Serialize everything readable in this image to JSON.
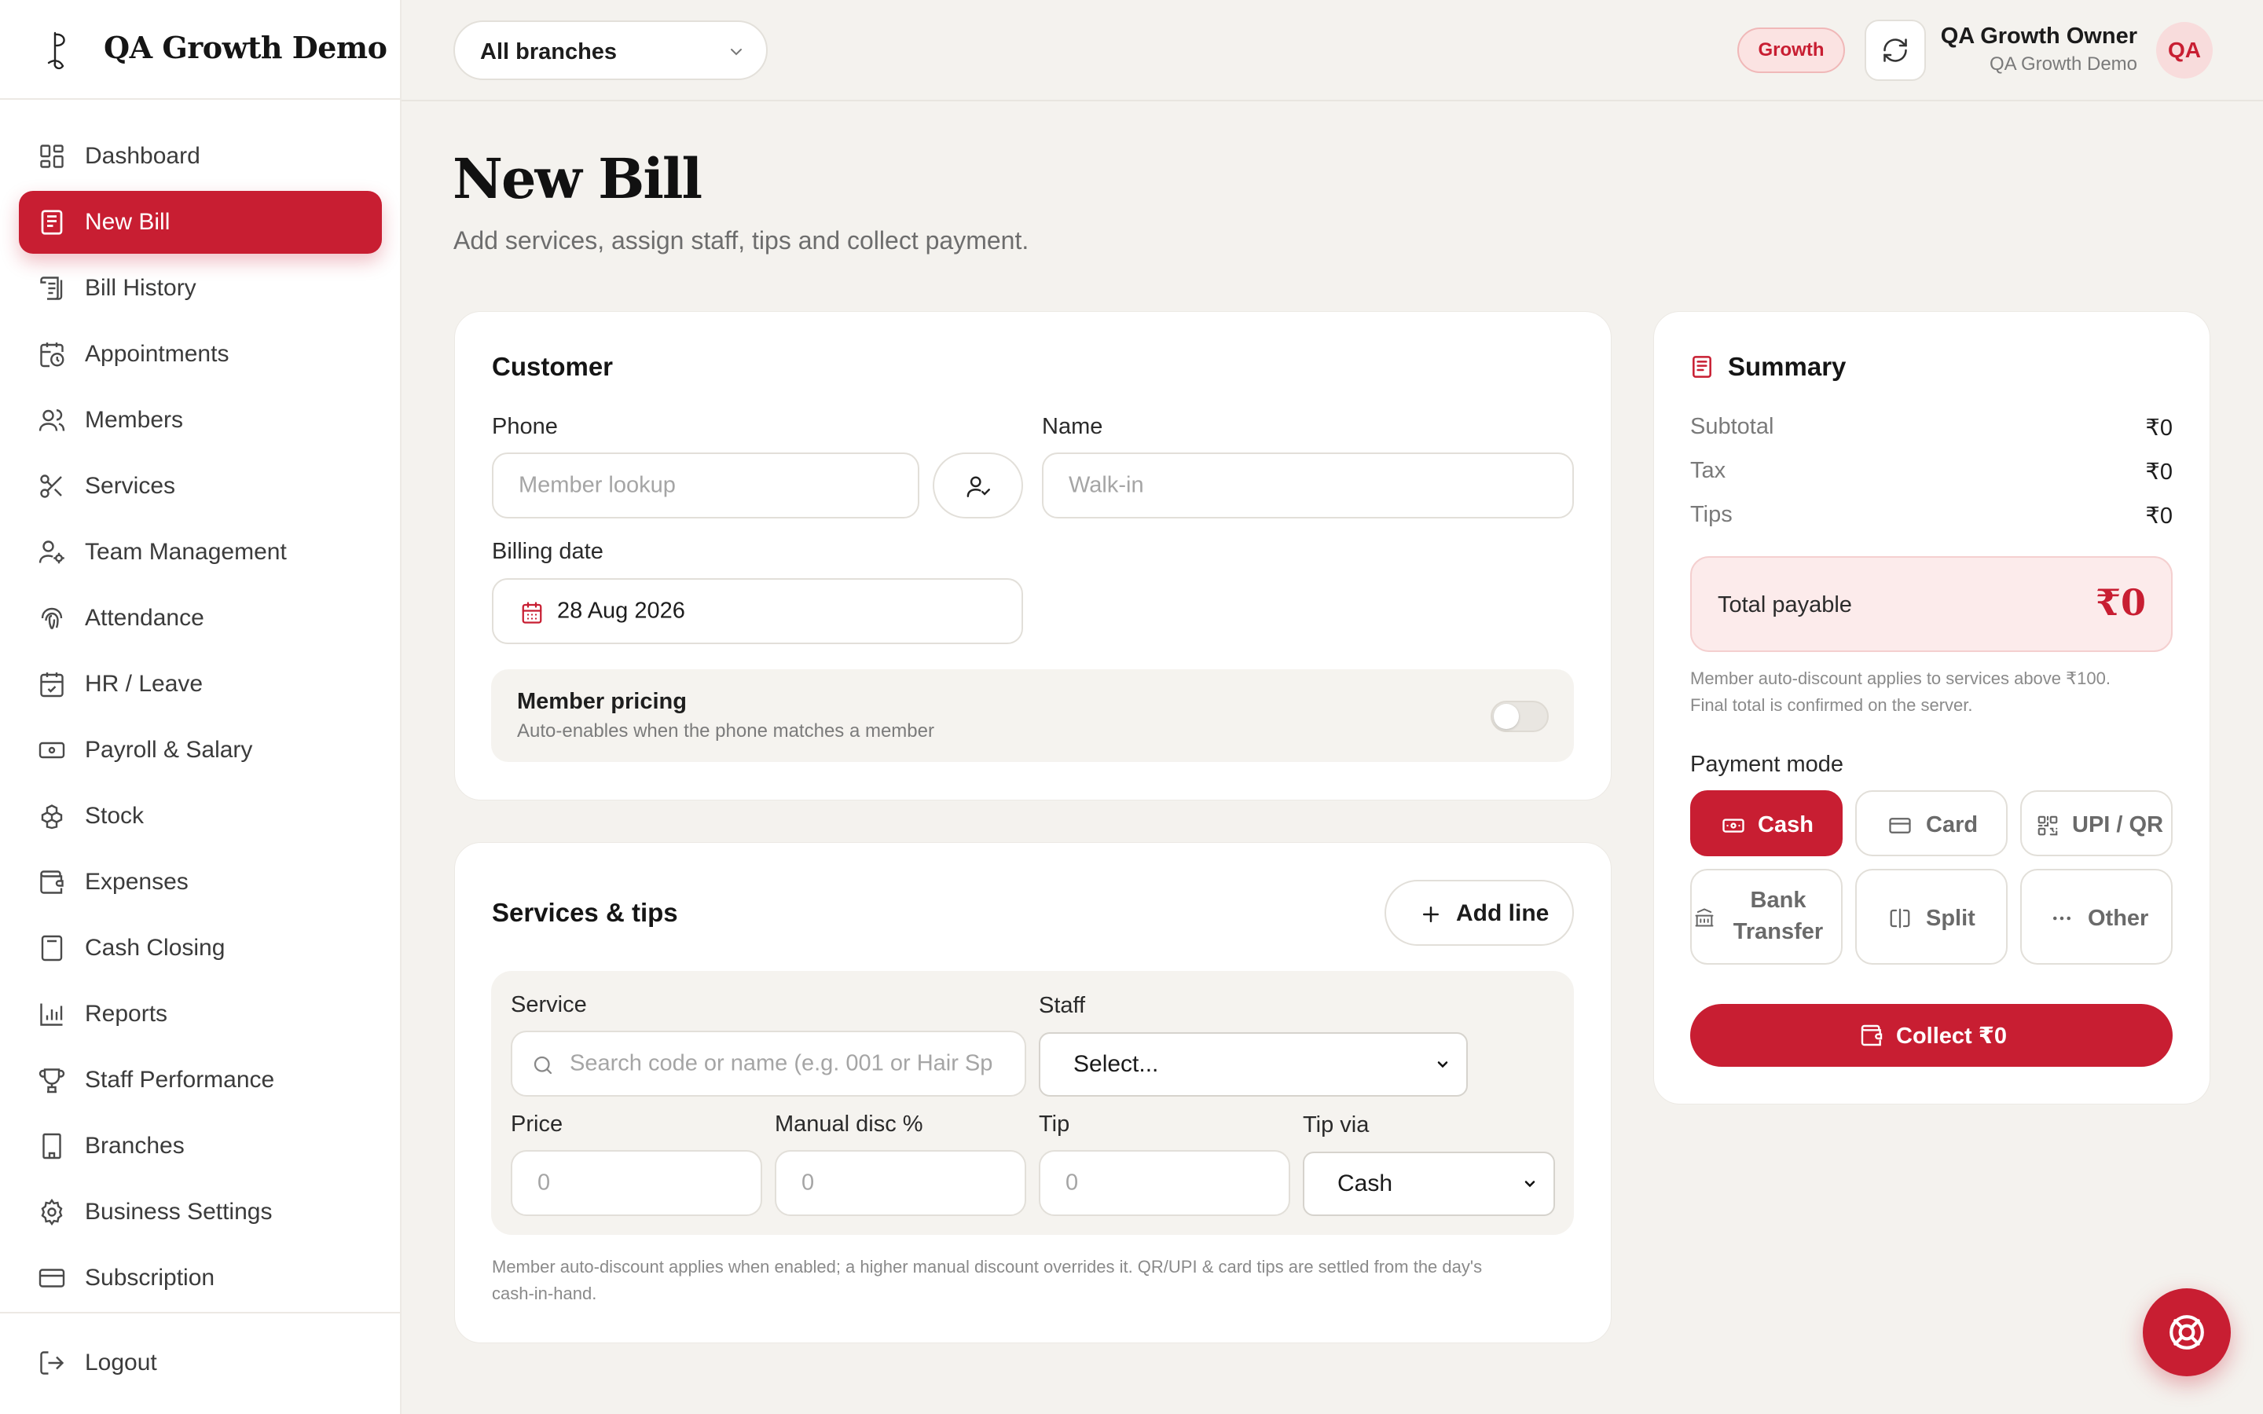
{
  "brand": {
    "name": "QA Growth Demo"
  },
  "sidebar": {
    "items": [
      {
        "label": "Dashboard",
        "icon": "dashboard-icon",
        "active": false
      },
      {
        "label": "New Bill",
        "icon": "receipt-icon",
        "active": true
      },
      {
        "label": "Bill History",
        "icon": "scroll-icon",
        "active": false
      },
      {
        "label": "Appointments",
        "icon": "calendar-clock-icon",
        "active": false
      },
      {
        "label": "Members",
        "icon": "users-icon",
        "active": false
      },
      {
        "label": "Services",
        "icon": "scissors-icon",
        "active": false
      },
      {
        "label": "Team Management",
        "icon": "user-cog-icon",
        "active": false
      },
      {
        "label": "Attendance",
        "icon": "fingerprint-icon",
        "active": false
      },
      {
        "label": "HR / Leave",
        "icon": "calendar-check-icon",
        "active": false
      },
      {
        "label": "Payroll & Salary",
        "icon": "banknote-icon",
        "active": false
      },
      {
        "label": "Stock",
        "icon": "boxes-icon",
        "active": false
      },
      {
        "label": "Expenses",
        "icon": "wallet-icon",
        "active": false
      },
      {
        "label": "Cash Closing",
        "icon": "calculator-icon",
        "active": false
      },
      {
        "label": "Reports",
        "icon": "bar-chart-icon",
        "active": false
      },
      {
        "label": "Staff Performance",
        "icon": "trophy-icon",
        "active": false
      },
      {
        "label": "Branches",
        "icon": "building-icon",
        "active": false
      },
      {
        "label": "Business Settings",
        "icon": "gear-icon",
        "active": false
      },
      {
        "label": "Subscription",
        "icon": "credit-card-icon",
        "active": false
      }
    ],
    "logout_label": "Logout"
  },
  "topbar": {
    "branch_selected": "All branches",
    "plan_badge": "Growth",
    "user_name": "QA Growth Owner",
    "user_org": "QA Growth Demo",
    "avatar_initials": "QA"
  },
  "page": {
    "title": "New Bill",
    "subtitle": "Add services, assign staff, tips and collect payment."
  },
  "customer": {
    "title": "Customer",
    "phone_label": "Phone",
    "phone_placeholder": "Member lookup",
    "name_label": "Name",
    "name_placeholder": "Walk-in",
    "billing_date_label": "Billing date",
    "billing_date_value": "28 Aug 2026",
    "member_pricing_title": "Member pricing",
    "member_pricing_desc": "Auto-enables when the phone matches a member",
    "member_pricing_enabled": false
  },
  "services": {
    "title": "Services & tips",
    "add_line_label": "Add line",
    "service_label": "Service",
    "service_placeholder": "Search code or name (e.g. 001 or Hair Sp",
    "staff_label": "Staff",
    "staff_selected": "Select...",
    "price_label": "Price",
    "price_placeholder": "0",
    "manual_disc_label": "Manual disc %",
    "manual_disc_placeholder": "0",
    "tip_label": "Tip",
    "tip_placeholder": "0",
    "tip_via_label": "Tip via",
    "tip_via_selected": "Cash",
    "footnote_line1": "Member auto-discount applies when enabled; a higher manual discount overrides it. QR/UPI & card tips are settled from the day's",
    "footnote_line2": "cash-in-hand."
  },
  "summary": {
    "title": "Summary",
    "subtotal_label": "Subtotal",
    "subtotal_value": "₹0",
    "tax_label": "Tax",
    "tax_value": "₹0",
    "tips_label": "Tips",
    "tips_value": "₹0",
    "total_label": "Total payable",
    "total_value": "₹0",
    "note_line1": "Member auto-discount applies to services above ₹100.",
    "note_line2": "Final total is confirmed on the server.",
    "payment_mode_label": "Payment mode",
    "payment_modes": [
      {
        "label": "Cash",
        "icon": "banknote-icon",
        "active": true
      },
      {
        "label": "Card",
        "icon": "credit-card-icon",
        "active": false
      },
      {
        "label": "UPI / QR",
        "icon": "qr-code-icon",
        "active": false
      },
      {
        "label_line1": "Bank",
        "label_line2": "Transfer",
        "icon": "bank-icon",
        "active": false
      },
      {
        "label": "Split",
        "icon": "split-icon",
        "active": false
      },
      {
        "label": "Other",
        "icon": "ellipsis-icon",
        "active": false
      }
    ],
    "collect_label": "Collect ₹0"
  },
  "colors": {
    "accent": "#c81e32",
    "background": "#f4f2ee",
    "card": "#ffffff"
  }
}
